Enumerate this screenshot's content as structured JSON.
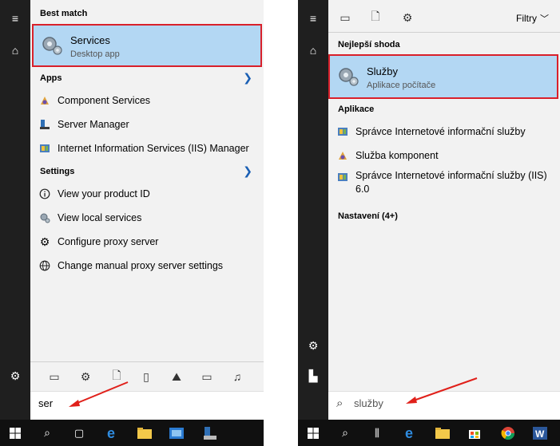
{
  "left": {
    "best_match_header": "Best match",
    "best": {
      "title": "Services",
      "sub": "Desktop app"
    },
    "apps_header": "Apps",
    "apps": [
      "Component Services",
      "Server Manager",
      "Internet Information Services (IIS) Manager"
    ],
    "settings_header": "Settings",
    "settings": [
      "View your product ID",
      "View local services",
      "Configure proxy server",
      "Change manual proxy server settings"
    ],
    "search_value": "ser"
  },
  "right": {
    "filters_label": "Filtry",
    "best_match_header": "Nejlepší shoda",
    "best": {
      "title": "Služby",
      "sub": "Aplikace počítače"
    },
    "apps_header": "Aplikace",
    "apps": [
      "Správce Internetové informační služby",
      "Služba komponent",
      "Správce Internetové informační služby (IIS) 6.0"
    ],
    "settings_header": "Nastavení (4+)",
    "search_value": "služby"
  },
  "colors": {
    "highlight": "#b3d7f3",
    "red_box": "#d9202a",
    "arrow": "#e0201a",
    "rail": "#1f1f1f",
    "taskbar": "#101010",
    "chevron": "#1a5fb4"
  }
}
